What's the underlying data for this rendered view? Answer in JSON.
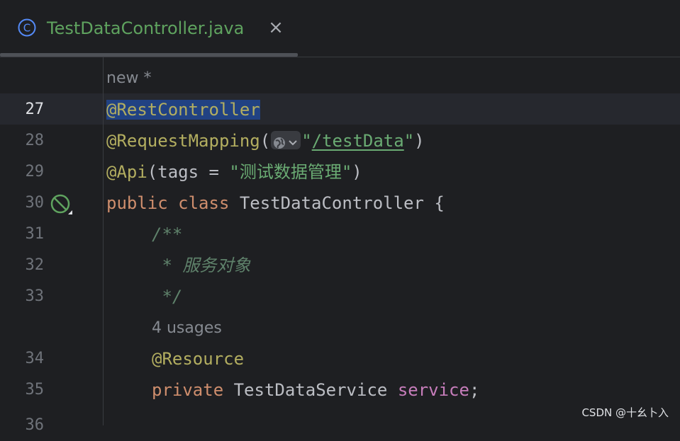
{
  "tab": {
    "title": "TestDataController.java",
    "close_glyph": "×",
    "icon": "class-c-icon",
    "title_color": "#5fa35f"
  },
  "editor": {
    "top_hint": "new *",
    "usages_hint": "4 usages",
    "current_line": "27",
    "lines": [
      {
        "n": "27"
      },
      {
        "n": "28"
      },
      {
        "n": "29"
      },
      {
        "n": "30"
      },
      {
        "n": "31"
      },
      {
        "n": "32"
      },
      {
        "n": "33"
      },
      {
        "n": "34"
      },
      {
        "n": "35"
      },
      {
        "n": "36"
      }
    ],
    "code": {
      "l27": "@RestController",
      "l28_ann": "@RequestMapping",
      "l28_open": "(",
      "l28_q1": "\"",
      "l28_url": "/testData",
      "l28_q2": "\"",
      "l28_close": ")",
      "l29_ann": "@Api",
      "l29_mid": "(tags = ",
      "l29_str": "\"测试数据管理\"",
      "l29_close": ")",
      "l30_kw1": "public",
      "l30_kw2": "class",
      "l30_name": "TestDataController {",
      "l31": "/**",
      "l32": " * 服务对象",
      "l33": " */",
      "l34": "@Resource",
      "l35_kw": "private",
      "l35_type": "TestDataService",
      "l35_field": "service",
      "l35_end": ";"
    },
    "gutter_icon": "no-entry-icon"
  },
  "watermark": "CSDN @十幺卜入"
}
